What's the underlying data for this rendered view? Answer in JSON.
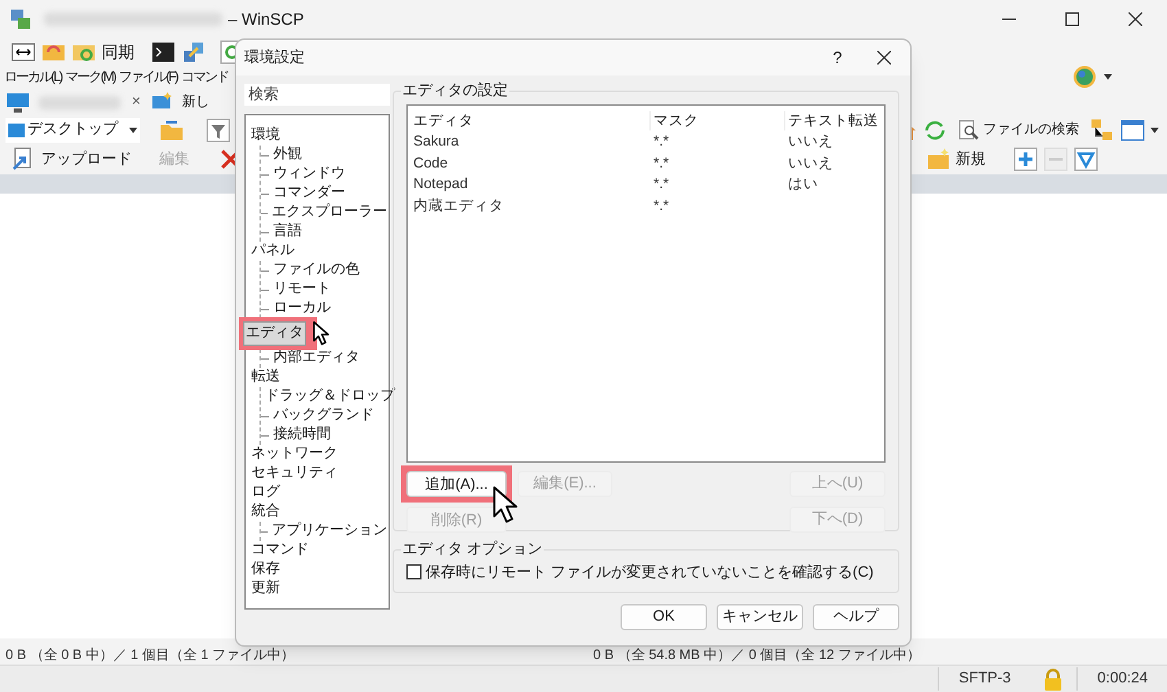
{
  "main_window": {
    "title": "– WinSCP",
    "toolbar": {
      "sync_label": "同期"
    },
    "menu": [
      "ローカル(L)",
      "マーク(M)",
      "ファイル(F)",
      "コマンド"
    ],
    "session_tab": {
      "close": "×",
      "new_session": "新し"
    },
    "local_path": "デスクトップ",
    "local_actions": [
      {
        "label": "アップロード",
        "disabled": false
      },
      {
        "label": "編集",
        "disabled": true
      }
    ],
    "remote_toolbar": {
      "find_files": "ファイルの検索",
      "new": "新規"
    },
    "status_local": "0 B （全 0 B 中）／ 1 個目（全 1 ファイル中）",
    "status_remote": "0 B （全 54.8 MB 中）／ 0 個目（全 12 ファイル中）",
    "protocol": "SFTP-3",
    "elapsed": "0:00:24"
  },
  "dialog": {
    "title": "環境設定",
    "help": "?",
    "search": {
      "placeholder": "検索"
    },
    "tree": [
      {
        "label": "環境",
        "selected": false,
        "highlighted": false,
        "children": [
          {
            "label": "外観",
            "selected": false,
            "highlighted": false
          },
          {
            "label": "ウィンドウ",
            "selected": false,
            "highlighted": false
          },
          {
            "label": "コマンダー",
            "selected": false,
            "highlighted": false
          },
          {
            "label": "エクスプローラー",
            "selected": false,
            "highlighted": false
          },
          {
            "label": "言語",
            "selected": false,
            "highlighted": false
          }
        ]
      },
      {
        "label": "パネル",
        "selected": false,
        "highlighted": false,
        "children": [
          {
            "label": "ファイルの色",
            "selected": false,
            "highlighted": false
          },
          {
            "label": "リモート",
            "selected": false,
            "highlighted": false
          },
          {
            "label": "ローカル",
            "selected": false,
            "highlighted": false
          }
        ]
      },
      {
        "label": "エディタ",
        "selected": true,
        "highlighted": true,
        "children": [
          {
            "label": "内部エディタ",
            "selected": false,
            "highlighted": false
          }
        ]
      },
      {
        "label": "転送",
        "selected": false,
        "highlighted": false,
        "children": [
          {
            "label": "ドラッグ＆ドロップ",
            "selected": false,
            "highlighted": false
          },
          {
            "label": "バックグランド",
            "selected": false,
            "highlighted": false
          },
          {
            "label": "接続時間",
            "selected": false,
            "highlighted": false
          }
        ]
      },
      {
        "label": "ネットワーク",
        "selected": false,
        "highlighted": false
      },
      {
        "label": "セキュリティ",
        "selected": false,
        "highlighted": false
      },
      {
        "label": "ログ",
        "selected": false,
        "highlighted": false
      },
      {
        "label": "統合",
        "selected": false,
        "highlighted": false,
        "children": [
          {
            "label": "アプリケーション",
            "selected": false,
            "highlighted": false
          }
        ]
      },
      {
        "label": "コマンド",
        "selected": false,
        "highlighted": false
      },
      {
        "label": "保存",
        "selected": false,
        "highlighted": false
      },
      {
        "label": "更新",
        "selected": false,
        "highlighted": false
      }
    ],
    "editors_group": {
      "title": "エディタの設定",
      "columns": [
        "エディタ",
        "マスク",
        "テキスト転送"
      ],
      "rows": [
        [
          "Sakura",
          "*.*",
          "いいえ"
        ],
        [
          "Code",
          "*.*",
          "いいえ"
        ],
        [
          "Notepad",
          "*.*",
          "はい"
        ],
        [
          "内蔵エディタ",
          "*.*",
          ""
        ]
      ],
      "buttons_left": [
        {
          "label": "追加(A)...",
          "disabled": false,
          "highlighted": true
        },
        {
          "label": "編集(E)...",
          "disabled": true,
          "highlighted": false
        },
        {
          "label": "削除(R)",
          "disabled": true,
          "highlighted": false
        }
      ],
      "buttons_right": [
        {
          "label": "上へ(U)",
          "disabled": true,
          "highlighted": false
        },
        {
          "label": "下へ(D)",
          "disabled": true,
          "highlighted": false
        }
      ]
    },
    "options_group": {
      "title": "エディタ オプション",
      "checkbox": {
        "label": "保存時にリモート ファイルが変更されていないことを確認する(C)",
        "checked": false
      }
    },
    "footer_buttons": [
      {
        "label": "OK",
        "disabled": false,
        "highlighted": false
      },
      {
        "label": "キャンセル",
        "disabled": false,
        "highlighted": false
      },
      {
        "label": "ヘルプ",
        "disabled": false,
        "highlighted": false
      }
    ]
  }
}
